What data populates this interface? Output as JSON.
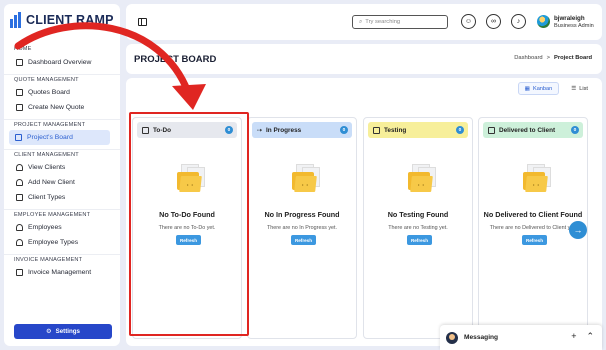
{
  "app": {
    "logo_text": "CLIENT RAMP"
  },
  "sidebar": {
    "sections": [
      {
        "title": "HOME",
        "items": [
          {
            "label": "Dashboard Overview",
            "icon": "dashboard-icon"
          }
        ]
      },
      {
        "title": "QUOTE MANAGEMENT",
        "items": [
          {
            "label": "Quotes Board",
            "icon": "board-icon"
          },
          {
            "label": "Create New Quote",
            "icon": "edit-icon"
          }
        ]
      },
      {
        "title": "PROJECT MANAGEMENT",
        "items": [
          {
            "label": "Project's Board",
            "icon": "board-icon",
            "active": true
          }
        ]
      },
      {
        "title": "CLIENT MANAGEMENT",
        "items": [
          {
            "label": "View Clients",
            "icon": "user-icon"
          },
          {
            "label": "Add New Client",
            "icon": "user-plus-icon"
          },
          {
            "label": "Client Types",
            "icon": "tag-icon"
          }
        ]
      },
      {
        "title": "EMPLOYEE MANAGEMENT",
        "items": [
          {
            "label": "Employees",
            "icon": "user-icon"
          },
          {
            "label": "Employee Types",
            "icon": "user-icon"
          }
        ]
      },
      {
        "title": "INVOICE MANAGEMENT",
        "items": [
          {
            "label": "Invoice Management",
            "icon": "invoice-icon"
          }
        ]
      }
    ],
    "settings_label": "Settings"
  },
  "topbar": {
    "search_placeholder": "Try searching",
    "user_name": "bjwraleigh",
    "user_role": "Business Admin"
  },
  "page": {
    "title": "PROJECT BOARD",
    "breadcrumb_home": "Dashboard",
    "breadcrumb_sep": ">",
    "breadcrumb_current": "Project Board"
  },
  "view": {
    "kanban_label": "Kanban",
    "list_label": "List"
  },
  "columns": [
    {
      "title": "To-Do",
      "count": "0",
      "header_color": "#e6e8ee",
      "empty_title": "No To-Do Found",
      "empty_sub": "There are no To-Do yet.",
      "refresh_label": "Refresh"
    },
    {
      "title": "In Progress",
      "count": "0",
      "header_color": "#c9ddf8",
      "empty_title": "No In Progress Found",
      "empty_sub": "There are no In Progress yet.",
      "refresh_label": "Refresh"
    },
    {
      "title": "Testing",
      "count": "0",
      "header_color": "#f7ef9a",
      "empty_title": "No Testing Found",
      "empty_sub": "There are no Testing yet.",
      "refresh_label": "Refresh"
    },
    {
      "title": "Delivered to Client",
      "count": "0",
      "header_color": "#cdf0da",
      "empty_title": "No Delivered to Client Found",
      "empty_sub": "There are no Delivered to Client yet.",
      "refresh_label": "Refresh"
    }
  ],
  "messaging": {
    "label": "Messaging"
  }
}
